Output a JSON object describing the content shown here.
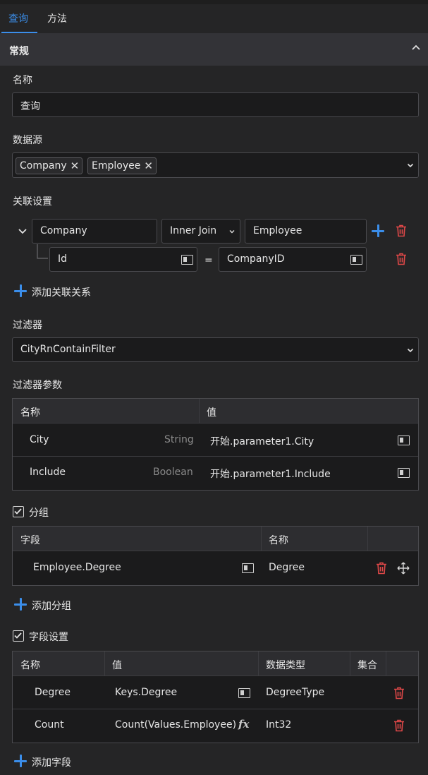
{
  "tabs": [
    {
      "label": "查询",
      "active": true
    },
    {
      "label": "方法",
      "active": false
    }
  ],
  "section": {
    "title": "常规"
  },
  "name_field": {
    "label": "名称",
    "value": "查询"
  },
  "datasource": {
    "label": "数据源",
    "chips": [
      "Company",
      "Employee"
    ]
  },
  "join": {
    "label": "关联设置",
    "left": "Company",
    "type": "Inner Join",
    "right": "Employee",
    "condition_left": "Id",
    "operator": "=",
    "condition_right": "CompanyID",
    "add_label": "添加关联关系"
  },
  "filter": {
    "label": "过滤器",
    "value": "CityRnContainFilter"
  },
  "filter_params": {
    "label": "过滤器参数",
    "headers": [
      "名称",
      "值"
    ],
    "rows": [
      {
        "name": "City",
        "type": "String",
        "value": "开始.parameter1.City"
      },
      {
        "name": "Include",
        "type": "Boolean",
        "value": "开始.parameter1.Include"
      }
    ]
  },
  "grouping": {
    "label": "分组",
    "checked": true,
    "headers": [
      "字段",
      "名称"
    ],
    "rows": [
      {
        "field": "Employee.Degree",
        "name": "Degree"
      }
    ],
    "add_label": "添加分组"
  },
  "field_settings": {
    "label": "字段设置",
    "checked": true,
    "headers": [
      "名称",
      "值",
      "数据类型",
      "集合"
    ],
    "rows": [
      {
        "name": "Degree",
        "value": "Keys.Degree",
        "type": "DegreeType"
      },
      {
        "name": "Count",
        "value": "Count(Values.Employee)",
        "type": "Int32"
      }
    ],
    "add_label": "添加字段"
  },
  "colors": {
    "accent": "#3b8eea",
    "danger": "#e04848",
    "background": "#252526"
  }
}
